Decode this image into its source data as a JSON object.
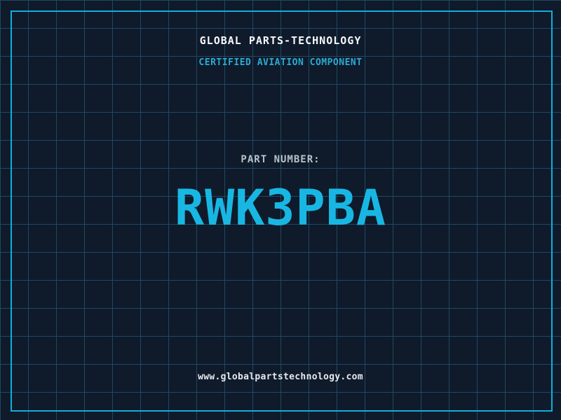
{
  "page": {
    "title": "GLOBAL PARTS-TECHNOLOGY",
    "subtitle": "CERTIFIED AVIATION COMPONENT",
    "part_label": "PART NUMBER:",
    "part_number": "RWK3PBA",
    "website": "www.globalpartstechnology.com"
  },
  "colors": {
    "background": "#0f1a2a",
    "grid_line": "#1d4a63",
    "frame_border": "#10aedd",
    "title_text": "#f5f7fa",
    "subtitle_text": "#2da9d2",
    "part_label_text": "#b9c2cb",
    "part_number_text": "#18b7e3",
    "website_text": "#e4e9ec"
  }
}
